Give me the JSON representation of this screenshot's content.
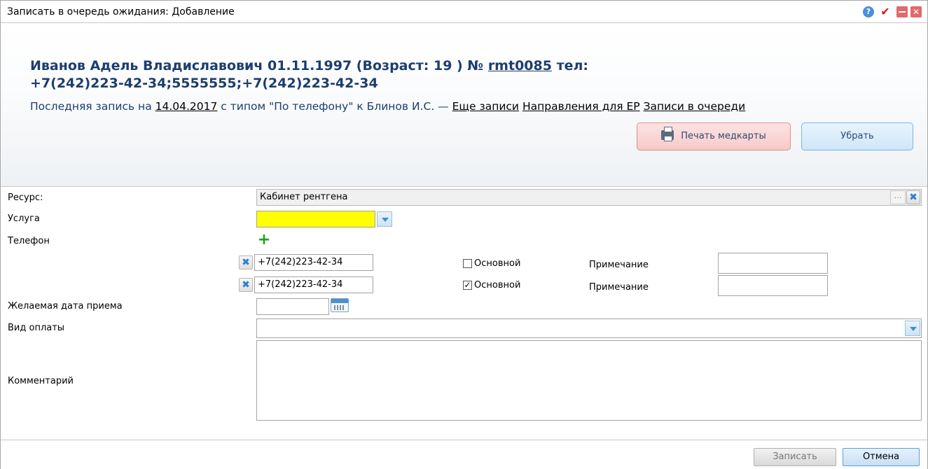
{
  "window": {
    "title": "Записать в очередь ожидания: Добавление"
  },
  "header": {
    "patient": {
      "name_prefix": "Иванов Адель Владиславович 01.11.1997 (Возраст: 19 ) № ",
      "record_number": "rmt0085",
      "phone_label": " тел:",
      "phones": "+7(242)223-42-34;5555555;+7(242)223-42-34"
    },
    "last_record": {
      "prefix": "Последняя запись на ",
      "date": "14.04.2017",
      "middle": " с типом \"По телефону\" к Блинов И.С. — ",
      "link_more": "Еще записи",
      "link_directions": "Направления для ЕР",
      "link_queue": "Записи в очереди"
    },
    "print_button": "Печать медкарты",
    "remove_button": "Убрать"
  },
  "form": {
    "resource": {
      "label": "Ресурс:",
      "value": "Кабинет рентгена"
    },
    "service": {
      "label": "Услуга",
      "value": ""
    },
    "phone": {
      "label": "Телефон",
      "rows": [
        {
          "number": "+7(242)223-42-34",
          "main_checked": false,
          "main_label": "Основной",
          "note_label": "Примечание",
          "note": ""
        },
        {
          "number": "+7(242)223-42-34",
          "main_checked": true,
          "main_label": "Основной",
          "note_label": "Примечание",
          "note": ""
        }
      ]
    },
    "desired_date": {
      "label": "Желаемая дата приема",
      "value": ""
    },
    "payment": {
      "label": "Вид оплаты",
      "value": ""
    },
    "comment": {
      "label": "Комментарий",
      "value": ""
    }
  },
  "footer": {
    "save_button": "Записать",
    "cancel_button": "Отмена"
  },
  "colors": {
    "header_text": "#1d3d6d",
    "required_field": "#ffff00",
    "print_button_bg": "#fde3e3",
    "remove_button_bg": "#e8f4fd"
  }
}
